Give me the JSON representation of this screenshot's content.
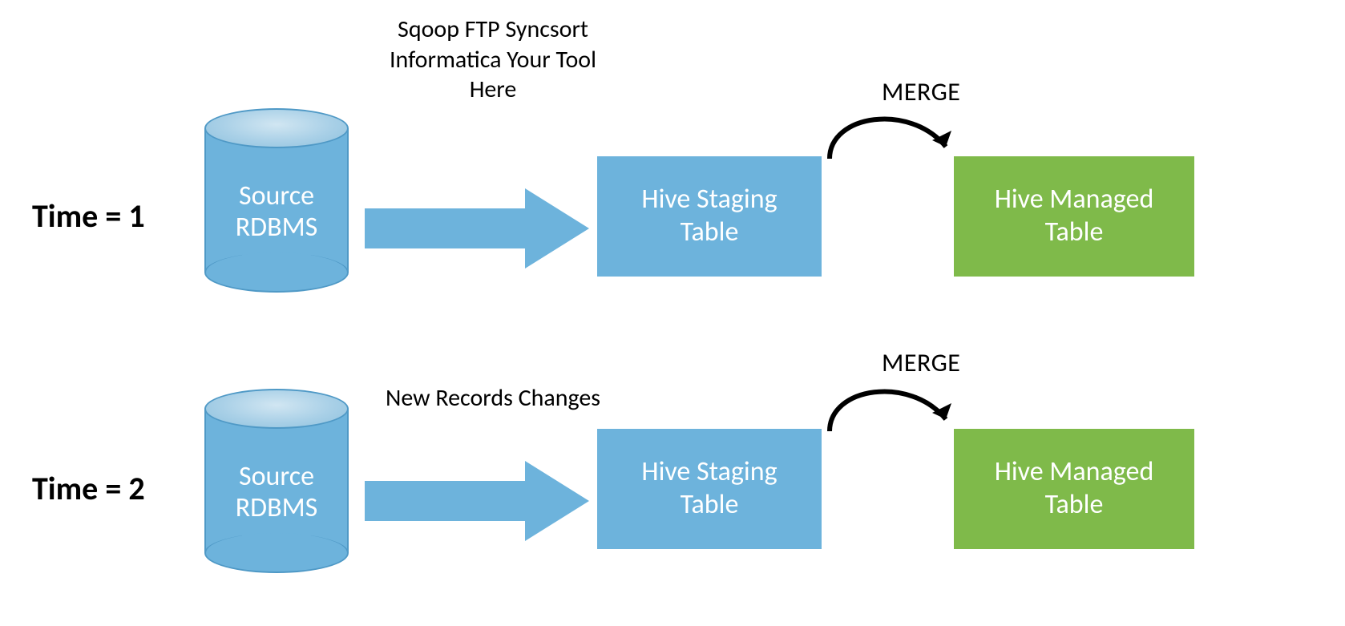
{
  "rows": {
    "time1": {
      "label": "Time = 1",
      "source": "Source\nRDBMS",
      "arrow_caption": "Sqoop\nFTP\nSyncsort\nInformatica\nYour Tool Here",
      "staging": "Hive Staging\nTable",
      "merge_label": "MERGE",
      "managed": "Hive Managed\nTable"
    },
    "time2": {
      "label": "Time = 2",
      "source": "Source\nRDBMS",
      "arrow_caption": "New Records\nChanges",
      "staging": "Hive Staging\nTable",
      "merge_label": "MERGE",
      "managed": "Hive Managed\nTable"
    }
  },
  "colors": {
    "blue": "#6db3dc",
    "blue_dark": "#4f99c6",
    "green": "#7fba4a",
    "text_dark": "#000000",
    "text_light": "#ffffff"
  }
}
